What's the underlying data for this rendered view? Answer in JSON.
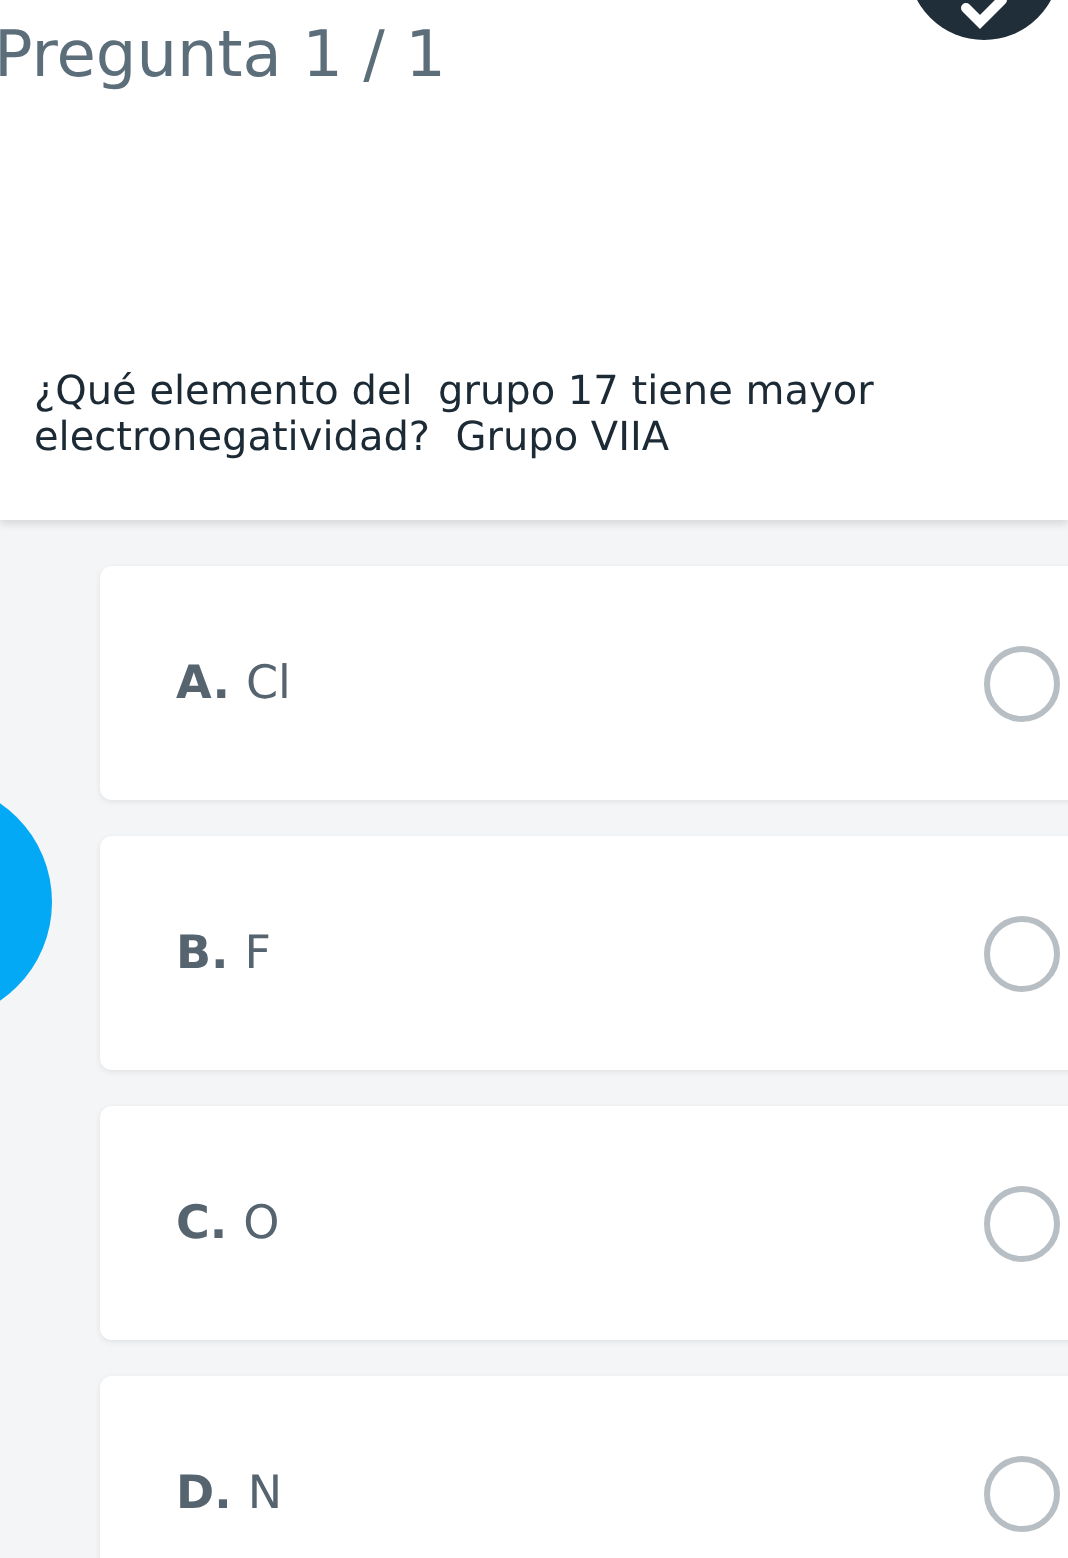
{
  "header": {
    "title": "Pregunta 1 / 1"
  },
  "question": {
    "text": "¿Qué elemento del  grupo 17 tiene mayor electronegatividad?  Grupo VIIA"
  },
  "options": [
    {
      "letter": "A.",
      "text": "Cl",
      "selected": false
    },
    {
      "letter": "B.",
      "text": "F",
      "selected": false
    },
    {
      "letter": "C.",
      "text": "O",
      "selected": false
    },
    {
      "letter": "D.",
      "text": "N",
      "selected": false
    }
  ]
}
